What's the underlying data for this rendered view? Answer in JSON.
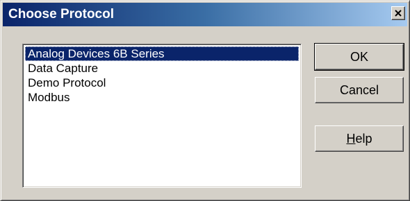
{
  "window": {
    "title": "Choose Protocol",
    "close_glyph": "×"
  },
  "protocol_list": {
    "items": [
      "Analog Devices 6B Series",
      "Data Capture",
      "Demo Protocol",
      "Modbus"
    ],
    "selected_index": 0
  },
  "buttons": {
    "ok_label": "OK",
    "cancel_label": "Cancel",
    "help_label_mnemonic": "H",
    "help_label_rest": "elp"
  },
  "colors": {
    "titlebar_start": "#0a246a",
    "titlebar_end": "#a6caf0",
    "selection_bg": "#0a246a",
    "dialog_face": "#d4d0c8"
  }
}
